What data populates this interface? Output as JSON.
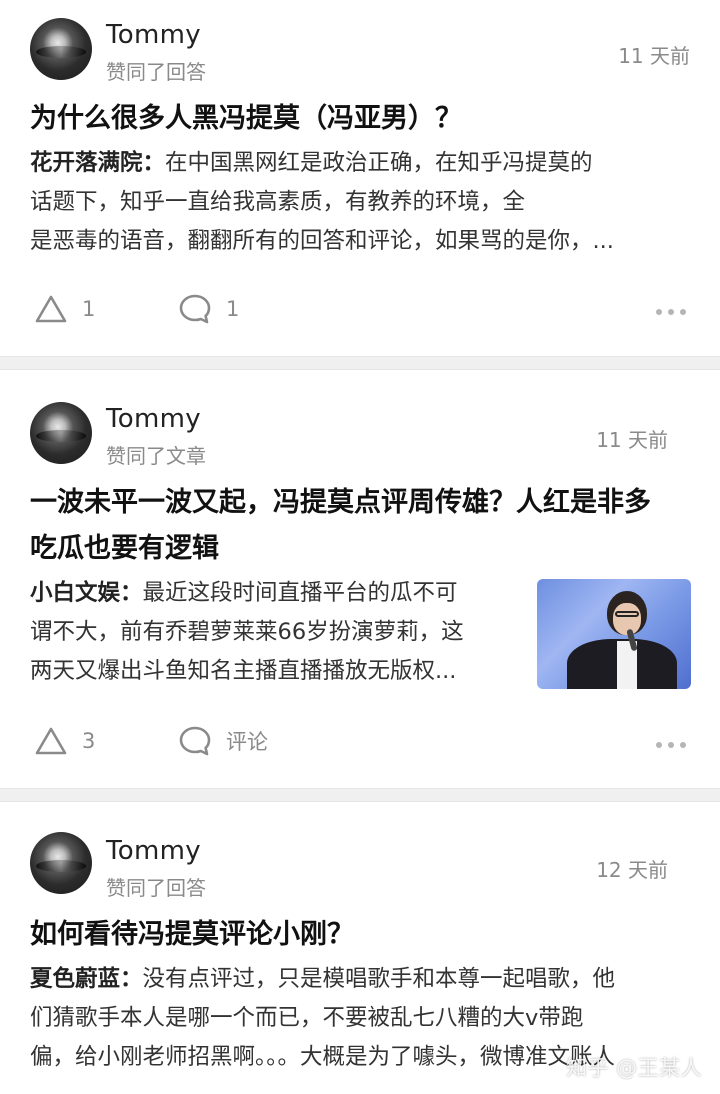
{
  "feed": [
    {
      "author": "Tommy",
      "action": "赞同了回答",
      "time": "11 天前",
      "title": "为什么很多人黑冯提莫（冯亚男）？",
      "excerpt_author": "花开落满院：",
      "excerpt_lines": [
        "在中国黑网红是政治正确，在知乎冯提莫的",
        "话题下，知乎一直给我高素质，有教养的环境，全",
        "是恶毒的语音，翻翻所有的回答和评论，如果骂的是你，..."
      ],
      "upvote_count": "1",
      "comment_label": "1"
    },
    {
      "author": "Tommy",
      "action": "赞同了文章",
      "time": "11 天前",
      "title_lines": [
        "一波未平一波又起，冯提莫点评周传雄？人红是非多",
        "吃瓜也要有逻辑"
      ],
      "excerpt_author": "小白文娱：",
      "excerpt_lines": [
        "最近这段时间直播平台的瓜不可",
        "谓不大，前有乔碧萝莱莱66岁扮演萝莉，这",
        "两天又爆出斗鱼知名主播直播播放无版权..."
      ],
      "upvote_count": "3",
      "comment_label": "评论"
    },
    {
      "author": "Tommy",
      "action": "赞同了回答",
      "time": "12 天前",
      "title": "如何看待冯提莫评论小刚？",
      "excerpt_author": "夏色蔚蓝：",
      "excerpt_lines": [
        "没有点评过，只是模唱歌手和本尊一起唱歌，他",
        "们猜歌手本人是哪一个而已，不要被乱七八糟的大v带跑",
        "偏，给小刚老师招黑啊。。。大概是为了噱头，微博准文账人"
      ]
    }
  ],
  "watermark": "知乎 @王某人"
}
